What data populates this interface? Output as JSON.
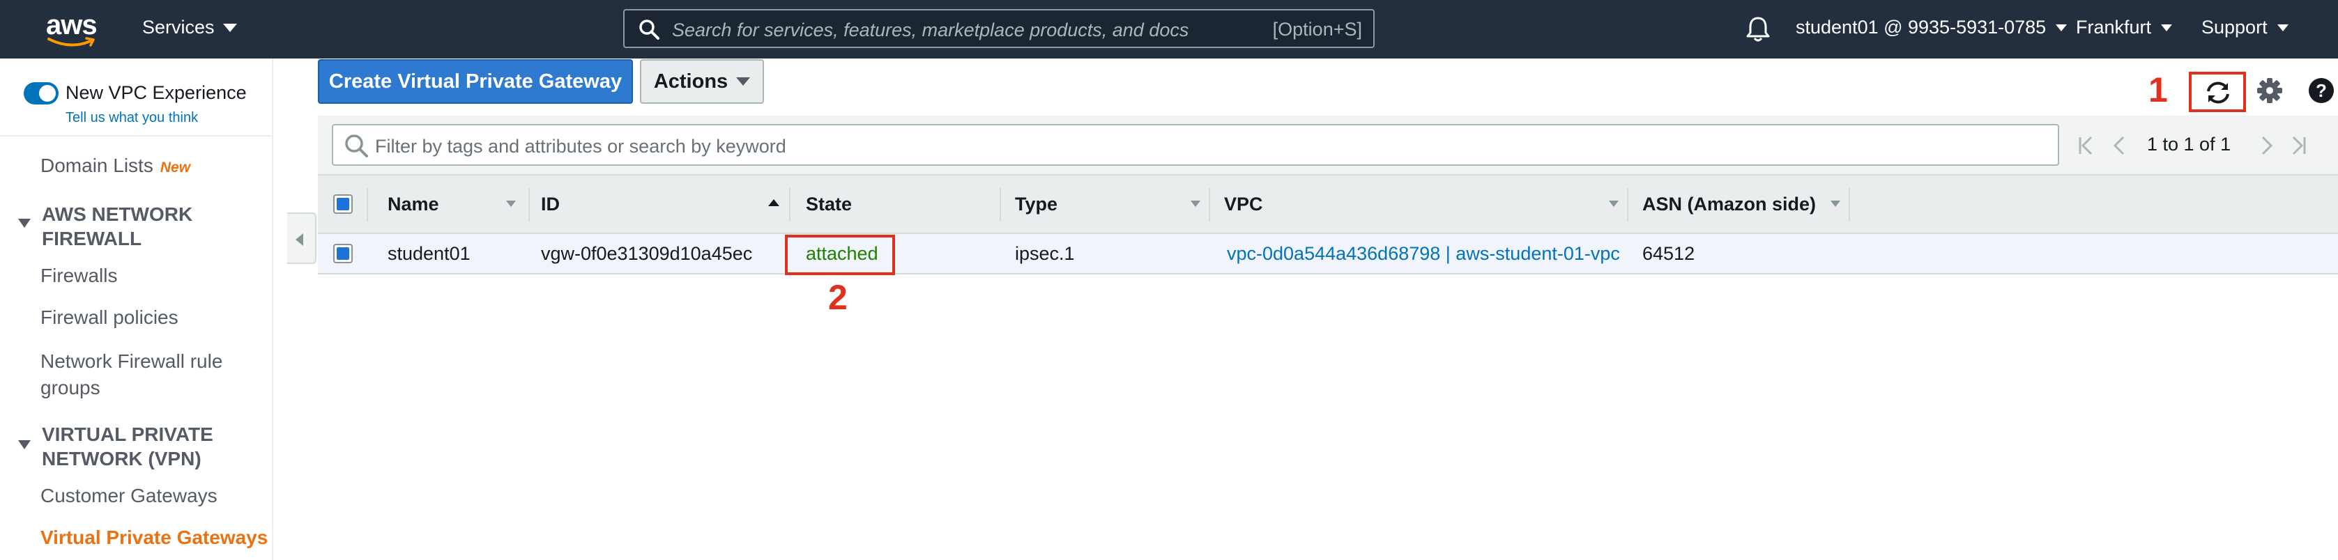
{
  "topnav": {
    "logo_text": "aws",
    "services_label": "Services",
    "search_placeholder": "Search for services, features, marketplace products, and docs",
    "search_shortcut": "[Option+S]",
    "account_label": "student01 @ 9935-5931-0785",
    "region_label": "Frankfurt",
    "support_label": "Support",
    "bell_icon": "bell-icon"
  },
  "sidebar": {
    "new_vpc_experience": "New VPC Experience",
    "tell_us": "Tell us what you think",
    "domain_lists": "Domain Lists",
    "new_badge": "New",
    "section_network_firewall": [
      "AWS NETWORK",
      "FIREWALL"
    ],
    "firewalls": "Firewalls",
    "firewall_policies": "Firewall policies",
    "network_firewall_rule_groups": [
      "Network Firewall rule",
      "groups"
    ],
    "section_vpn": [
      "VIRTUAL PRIVATE",
      "NETWORK (VPN)"
    ],
    "customer_gateways": "Customer Gateways",
    "virtual_private_gateways": "Virtual Private Gateways"
  },
  "toolbar": {
    "create_label": "Create Virtual Private Gateway",
    "actions_label": "Actions"
  },
  "annotations": {
    "one": "1",
    "two": "2"
  },
  "filter": {
    "placeholder": "Filter by tags and attributes or search by keyword"
  },
  "pagination": {
    "text": "1 to 1 of 1"
  },
  "table": {
    "headers": {
      "name": "Name",
      "id": "ID",
      "state": "State",
      "type": "Type",
      "vpc": "VPC",
      "asn": "ASN (Amazon side)"
    },
    "rows": [
      {
        "name": "student01",
        "id": "vgw-0f0e31309d10a45ec",
        "state": "attached",
        "type": "ipsec.1",
        "vpc": "vpc-0d0a544a436d68798 | aws-student-01-vpc",
        "asn": "64512"
      }
    ]
  },
  "colors": {
    "nav_bg": "#232f3e",
    "primary_button": "#2e7ad1",
    "active_link": "#ec7211",
    "attached_green": "#1d8102",
    "annotation_red": "#e0301e",
    "link_blue": "#0073bb"
  }
}
